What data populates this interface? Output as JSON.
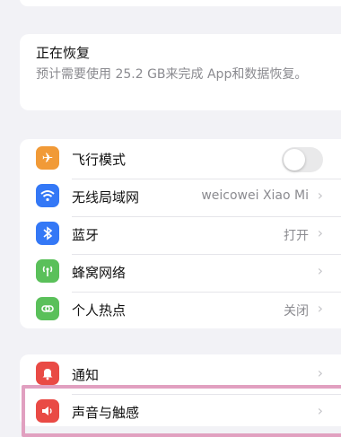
{
  "restore": {
    "title": "正在恢复",
    "description": "预计需要使用 25.2 GB来完成 App和数据恢复。"
  },
  "settings": {
    "items": [
      {
        "label": "飞行模式",
        "value": "",
        "icon": "airplane-icon",
        "color": "#f19a37",
        "toggle": "off"
      },
      {
        "label": "无线局域网",
        "value": "weicowei Xiao Mi",
        "icon": "wifi-icon",
        "color": "#3478f6"
      },
      {
        "label": "蓝牙",
        "value": "打开",
        "icon": "bluetooth-icon",
        "color": "#3478f6"
      },
      {
        "label": "蜂窝网络",
        "value": "",
        "icon": "cellular-antenna-icon",
        "color": "#5ac05a"
      },
      {
        "label": "个人热点",
        "value": "关闭",
        "icon": "hotspot-link-icon",
        "color": "#5ac05a"
      }
    ]
  },
  "notifications": {
    "items": [
      {
        "label": "通知",
        "icon": "bell-icon",
        "color": "#e94a45"
      },
      {
        "label": "声音与触感",
        "icon": "speaker-icon",
        "color": "#e94a45"
      }
    ]
  },
  "highlight_color": "#e1a0c0"
}
